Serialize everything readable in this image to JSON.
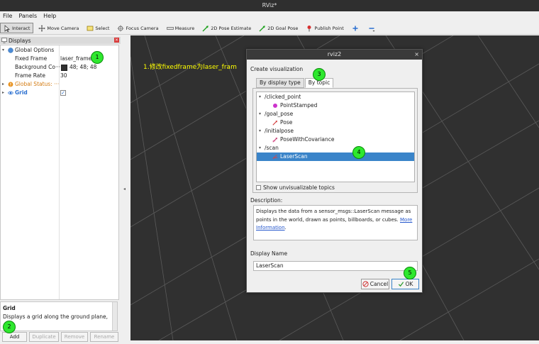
{
  "window": {
    "title": "RViz*"
  },
  "menu": {
    "items": [
      "File",
      "Panels",
      "Help"
    ]
  },
  "toolbar": {
    "interact": "Interact",
    "move_camera": "Move Camera",
    "select": "Select",
    "focus_camera": "Focus Camera",
    "measure": "Measure",
    "pose_estimate": "2D Pose Estimate",
    "goal_pose": "2D Goal Pose",
    "publish_point": "Publish Point"
  },
  "displays_panel": {
    "title": "Displays",
    "global_options": "Global Options",
    "fixed_frame_label": "Fixed Frame",
    "fixed_frame_value": "laser_frame",
    "background_label": "Background Co···",
    "background_value": "48; 48; 48",
    "background_color": "#303030",
    "frame_rate_label": "Frame Rate",
    "frame_rate_value": "30",
    "global_status": "Global Status: ···",
    "grid_label": "Grid",
    "grid_checked": "✓"
  },
  "description_panel": {
    "title": "Grid",
    "text": "Displays a grid along the ground plane,"
  },
  "panel_buttons": {
    "add": "Add",
    "duplicate": "Duplicate",
    "remove": "Remove",
    "rename": "Rename"
  },
  "annotation": {
    "text": "1.修改fixedframe为laser_fram"
  },
  "badges": {
    "b1": "1",
    "b2": "2",
    "b3": "3",
    "b4": "4",
    "b5": "5"
  },
  "dialog": {
    "title": "rviz2",
    "close": "×",
    "create_label": "Create visualization",
    "tab_display_type": "By display type",
    "tab_topic": "By topic",
    "topics": [
      {
        "topic": "/clicked_point",
        "type": "PointStamped"
      },
      {
        "topic": "/goal_pose",
        "type": "Pose"
      },
      {
        "topic": "/initialpose",
        "type": "PoseWithCovariance"
      },
      {
        "topic": "/scan",
        "type": "LaserScan"
      }
    ],
    "show_unvisualizable": "Show unvisualizable topics",
    "description_label": "Description:",
    "description_text": "Displays the data from a sensor_msgs::LaserScan message as points in the world, drawn as points, billboards, or cubes.",
    "more_info_1": "More",
    "more_info_2": "Information",
    "more_info_end": ".",
    "display_name_label": "Display Name",
    "display_name_value": "LaserScan",
    "cancel": "Cancel",
    "ok": "OK"
  },
  "colors": {
    "selection": "#3a84c9",
    "badge": "#2ee82e",
    "annotation": "#ffff00",
    "viewport": "#303030"
  }
}
